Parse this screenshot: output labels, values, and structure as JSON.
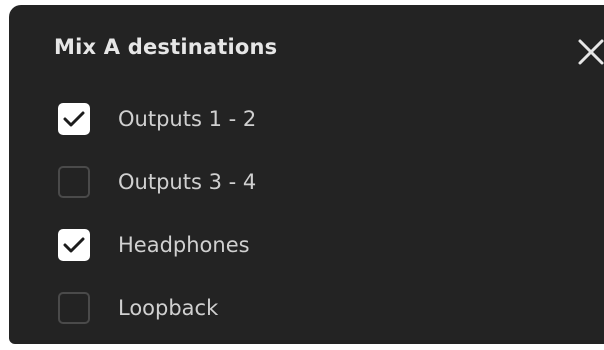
{
  "dialog": {
    "title": "Mix A destinations",
    "close_icon": "close-icon"
  },
  "options": [
    {
      "label": "Outputs 1 - 2",
      "checked": true
    },
    {
      "label": "Outputs 3 - 4",
      "checked": false
    },
    {
      "label": "Headphones",
      "checked": true
    },
    {
      "label": "Loopback",
      "checked": false
    }
  ],
  "colors": {
    "panel_bg": "#232323",
    "checkbox_checked": "#ffffff",
    "checkbox_unchecked_border": "#4a4a4a",
    "text": "#d0d0d0"
  }
}
